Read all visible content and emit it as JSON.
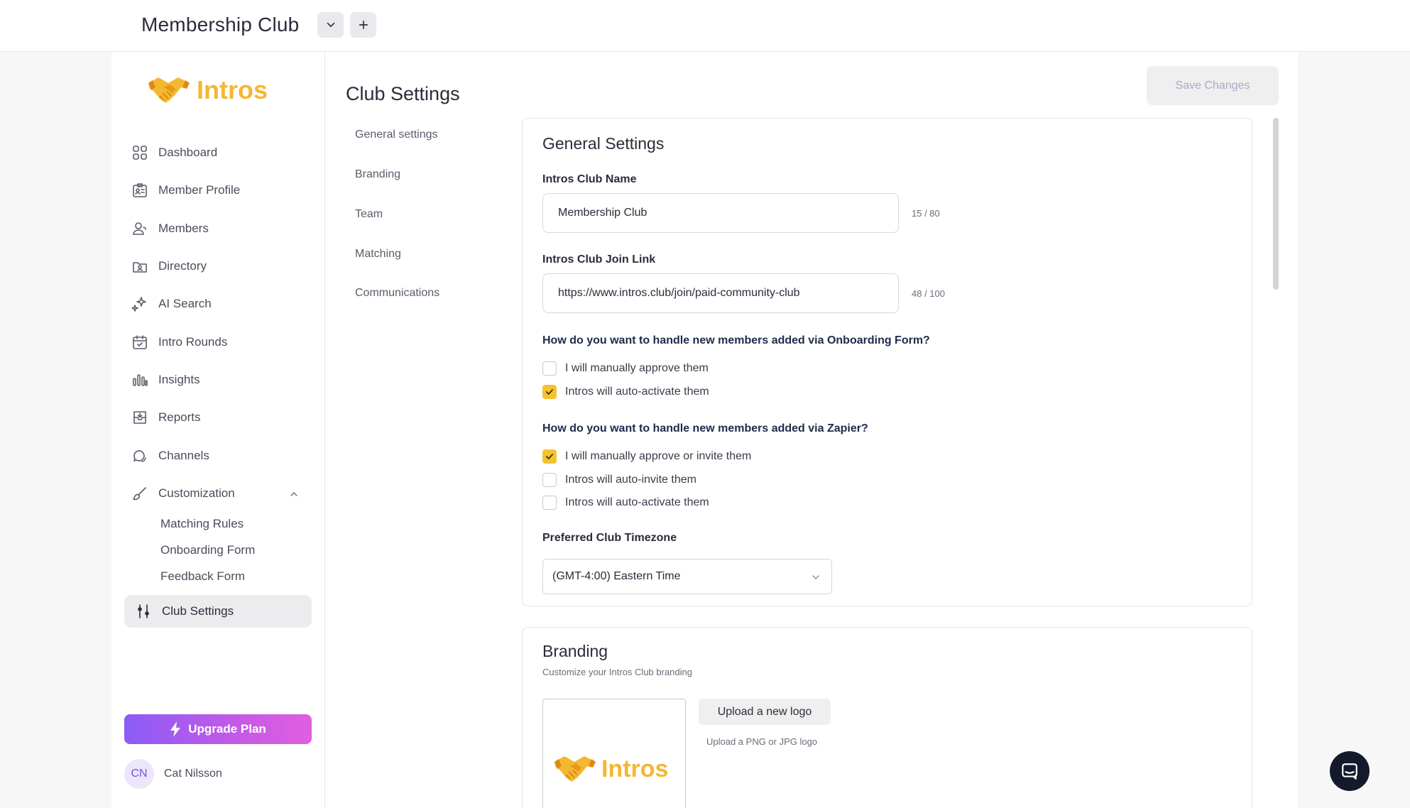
{
  "topbar": {
    "club_title": "Membership Club"
  },
  "sidebar": {
    "logo_text": "Intros",
    "nav": [
      {
        "label": "Dashboard",
        "icon": "grid-icon"
      },
      {
        "label": "Member Profile",
        "icon": "profile-card-icon"
      },
      {
        "label": "Members",
        "icon": "users-icon"
      },
      {
        "label": "Directory",
        "icon": "directory-icon"
      },
      {
        "label": "AI Search",
        "icon": "sparkle-icon"
      },
      {
        "label": "Intro Rounds",
        "icon": "calendar-icon"
      },
      {
        "label": "Insights",
        "icon": "bar-chart-icon"
      },
      {
        "label": "Reports",
        "icon": "inbox-icon"
      },
      {
        "label": "Channels",
        "icon": "chat-icon"
      },
      {
        "label": "Customization",
        "icon": "brush-icon"
      }
    ],
    "sub_items": [
      "Matching Rules",
      "Onboarding Form",
      "Feedback Form"
    ],
    "active_item": "Club Settings",
    "upgrade_label": "Upgrade Plan",
    "user": {
      "initials": "CN",
      "name": "Cat Nilsson"
    }
  },
  "main": {
    "title": "Club Settings",
    "save_label": "Save Changes",
    "subnav": [
      "General settings",
      "Branding",
      "Team",
      "Matching",
      "Communications"
    ],
    "general": {
      "title": "General Settings",
      "name_label": "Intros Club Name",
      "name_value": "Membership Club",
      "name_counter": "15 / 80",
      "link_label": "Intros Club Join Link",
      "link_value": "https://www.intros.club/join/paid-community-club",
      "link_counter": "48 / 100",
      "onboarding_question": "How do you want to handle new members added via Onboarding Form?",
      "onboarding_options": [
        {
          "label": "I will manually approve them",
          "checked": false
        },
        {
          "label": "Intros will auto-activate them",
          "checked": true
        }
      ],
      "zapier_question": "How do you want to handle new members added via Zapier?",
      "zapier_options": [
        {
          "label": "I will manually approve or invite them",
          "checked": true
        },
        {
          "label": "Intros will auto-invite them",
          "checked": false
        },
        {
          "label": "Intros will auto-activate them",
          "checked": false
        }
      ],
      "timezone_label": "Preferred Club Timezone",
      "timezone_value": "(GMT-4:00) Eastern Time"
    },
    "branding": {
      "title": "Branding",
      "subtitle": "Customize your Intros Club branding",
      "logo_text": "Intros",
      "upload_label": "Upload a new logo",
      "upload_hint": "Upload a PNG or JPG logo"
    }
  },
  "colors": {
    "accent_yellow": "#f5c22a",
    "logo_yellow": "#f4b731",
    "upgrade_gradient_start": "#8b5cf6",
    "upgrade_gradient_end": "#e05ee0",
    "chat_bubble": "#141a2c"
  }
}
